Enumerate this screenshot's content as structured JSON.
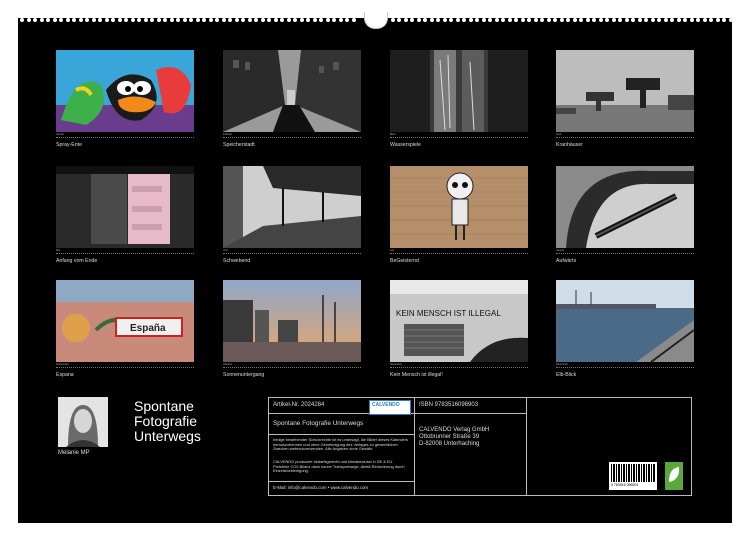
{
  "calendar": {
    "months": [
      {
        "month": "Januar",
        "caption": "Spray-Ente"
      },
      {
        "month": "Februar",
        "caption": "Speicherstadt"
      },
      {
        "month": "März",
        "caption": "Wasserspiele"
      },
      {
        "month": "April",
        "caption": "Kranhäuser"
      },
      {
        "month": "Mai",
        "caption": "Anfang vom Ende"
      },
      {
        "month": "Juni",
        "caption": "Schwebend"
      },
      {
        "month": "Juli",
        "caption": "BeGeisternd"
      },
      {
        "month": "August",
        "caption": "Aufwärts"
      },
      {
        "month": "September",
        "caption": "Espana"
      },
      {
        "month": "Oktober",
        "caption": "Sonnenuntergang"
      },
      {
        "month": "November",
        "caption": "Kein Mensch ist illegal!"
      },
      {
        "month": "Dezember",
        "caption": "Elb-Blick"
      }
    ]
  },
  "photo_text": {
    "espana": "España",
    "graffiti": "KEIN MENSCH IST ILLEGAL"
  },
  "cover": {
    "title": "Spontane Fotografie Unterwegs",
    "title_lines": [
      "Spontane",
      "Fotografie",
      "Unterwegs"
    ],
    "author": "Melanie MP"
  },
  "info": {
    "article_no": "Artikel-Nr. 2024284",
    "logo": "CALVENDO",
    "isbn": "ISBN 9783516096903",
    "subtitle": "Spontane Fotografie Unterwegs",
    "legal1": "Infolge bestehender Schutzrechte ist es untersagt, die Bilder dieses Kalenders herauszutrennen und ohne Genehmigung des Verlages zu gewerblichen Zwecken weiterzuverwenden. Alle Angaben ohne Gewähr.",
    "legal2": "CALVENDO produziert bedarfsgerecht und klimabewusst in DE & EU. Preisfreie CO2-Bilanz dank kurzer Transportwege, Abfall-Reduzierung durch Einzelstückfertigung.",
    "email": "E-Mail: info@calvendo.com • www.calvendo.com",
    "publisher": "CALVENDO Verlag GmbH",
    "street": "Ottobrunner Straße 39",
    "city": "D-82008 Unterhaching",
    "barcode_digits": "9 783516 096903"
  },
  "colors": {
    "background": "#000000",
    "border": "#ffffff",
    "eco_badge": "#5aa83a",
    "logo_blue": "#2b7bc4"
  }
}
